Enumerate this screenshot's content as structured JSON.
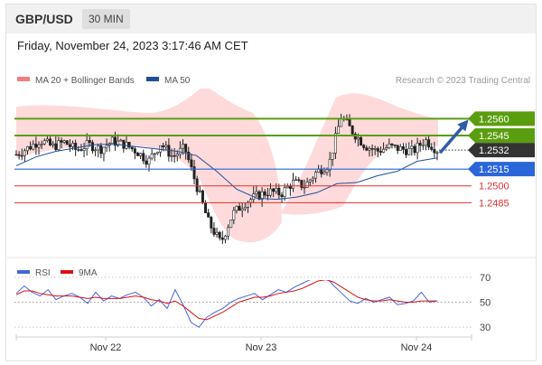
{
  "header": {
    "pair": "GBP/USD",
    "timeframe": "30 MIN"
  },
  "timestamp": "Friday, November 24, 2023 3:17:46 AM CET",
  "copyright": "Research © 2023 Trading Central",
  "colors": {
    "bollinger": "#f07f7f",
    "ma50": "#1f4f9a",
    "resistance": "#5a9e10",
    "current": "#333333",
    "pivot": "#2a66d9",
    "support": "#e03030",
    "rsi": "#4466dd",
    "rsi_ma": "#dd1111",
    "arrow": "#2f5da5"
  },
  "chart_data": [
    {
      "type": "candlestick",
      "legend": [
        "MA 20 + Bollinger Bands",
        "MA 50"
      ],
      "legend_placement": "top-left",
      "x_ticks": [
        "Nov 22",
        "Nov 23",
        "Nov 24"
      ],
      "ylim": [
        1.2436,
        1.2587
      ],
      "current_price": 1.2532,
      "levels": [
        {
          "value": 1.256,
          "label": "1.2560",
          "kind": "resistance"
        },
        {
          "value": 1.2545,
          "label": "1.2545",
          "kind": "resistance"
        },
        {
          "value": 1.2532,
          "label": "1.2532",
          "kind": "current"
        },
        {
          "value": 1.2515,
          "label": "1.2515",
          "kind": "pivot"
        },
        {
          "value": 1.25,
          "label": "1.2500",
          "kind": "support"
        },
        {
          "value": 1.2485,
          "label": "1.2485",
          "kind": "support"
        }
      ],
      "arrow": {
        "from": 1.2532,
        "to": 1.256,
        "direction": "up"
      },
      "close_path": [
        1.2528,
        1.2534,
        1.2541,
        1.2535,
        1.2539,
        1.2532,
        1.2537,
        1.2533,
        1.254,
        1.2537,
        1.2531,
        1.2522,
        1.2538,
        1.2526,
        1.2534,
        1.25,
        1.2467,
        1.2449,
        1.2475,
        1.2485,
        1.2491,
        1.2495,
        1.2493,
        1.2503,
        1.25,
        1.2513,
        1.2519,
        1.2562,
        1.2548,
        1.2536,
        1.2531,
        1.2535,
        1.2533,
        1.2531,
        1.2541,
        1.2532
      ],
      "ma50_path": [
        1.2518,
        1.2526,
        1.2531,
        1.2534,
        1.2537,
        1.2537,
        1.2535,
        1.2533,
        1.2531,
        1.2527,
        1.2513,
        1.2497,
        1.2489,
        1.2488,
        1.249,
        1.2494,
        1.2502,
        1.2503,
        1.2509,
        1.2513,
        1.2522,
        1.2525
      ]
    },
    {
      "type": "line",
      "legend": [
        "RSI",
        "9MA"
      ],
      "y_ticks": [
        "70",
        "50",
        "30"
      ],
      "ylim": [
        20,
        80
      ],
      "rsi": [
        57,
        63,
        58,
        55,
        60,
        52,
        55,
        57,
        54,
        49,
        58,
        51,
        55,
        53,
        56,
        58,
        54,
        47,
        52,
        45,
        60,
        48,
        34,
        30,
        38,
        42,
        45,
        50,
        53,
        55,
        57,
        52,
        56,
        60,
        58,
        62,
        65,
        68,
        75,
        70,
        63,
        57,
        51,
        49,
        53,
        50,
        52,
        54,
        48,
        49,
        51,
        58,
        50,
        51
      ],
      "rsi_ma": [
        56,
        59,
        59,
        57,
        56,
        55,
        55,
        55,
        54,
        53,
        54,
        53,
        53,
        53,
        54,
        55,
        54,
        52,
        51,
        49,
        51,
        47,
        42,
        37,
        36,
        39,
        42,
        46,
        50,
        52,
        54,
        54,
        55,
        57,
        58,
        59,
        61,
        64,
        67,
        68,
        66,
        62,
        58,
        54,
        52,
        51,
        51,
        52,
        51,
        50,
        50,
        51,
        51,
        51
      ]
    }
  ]
}
